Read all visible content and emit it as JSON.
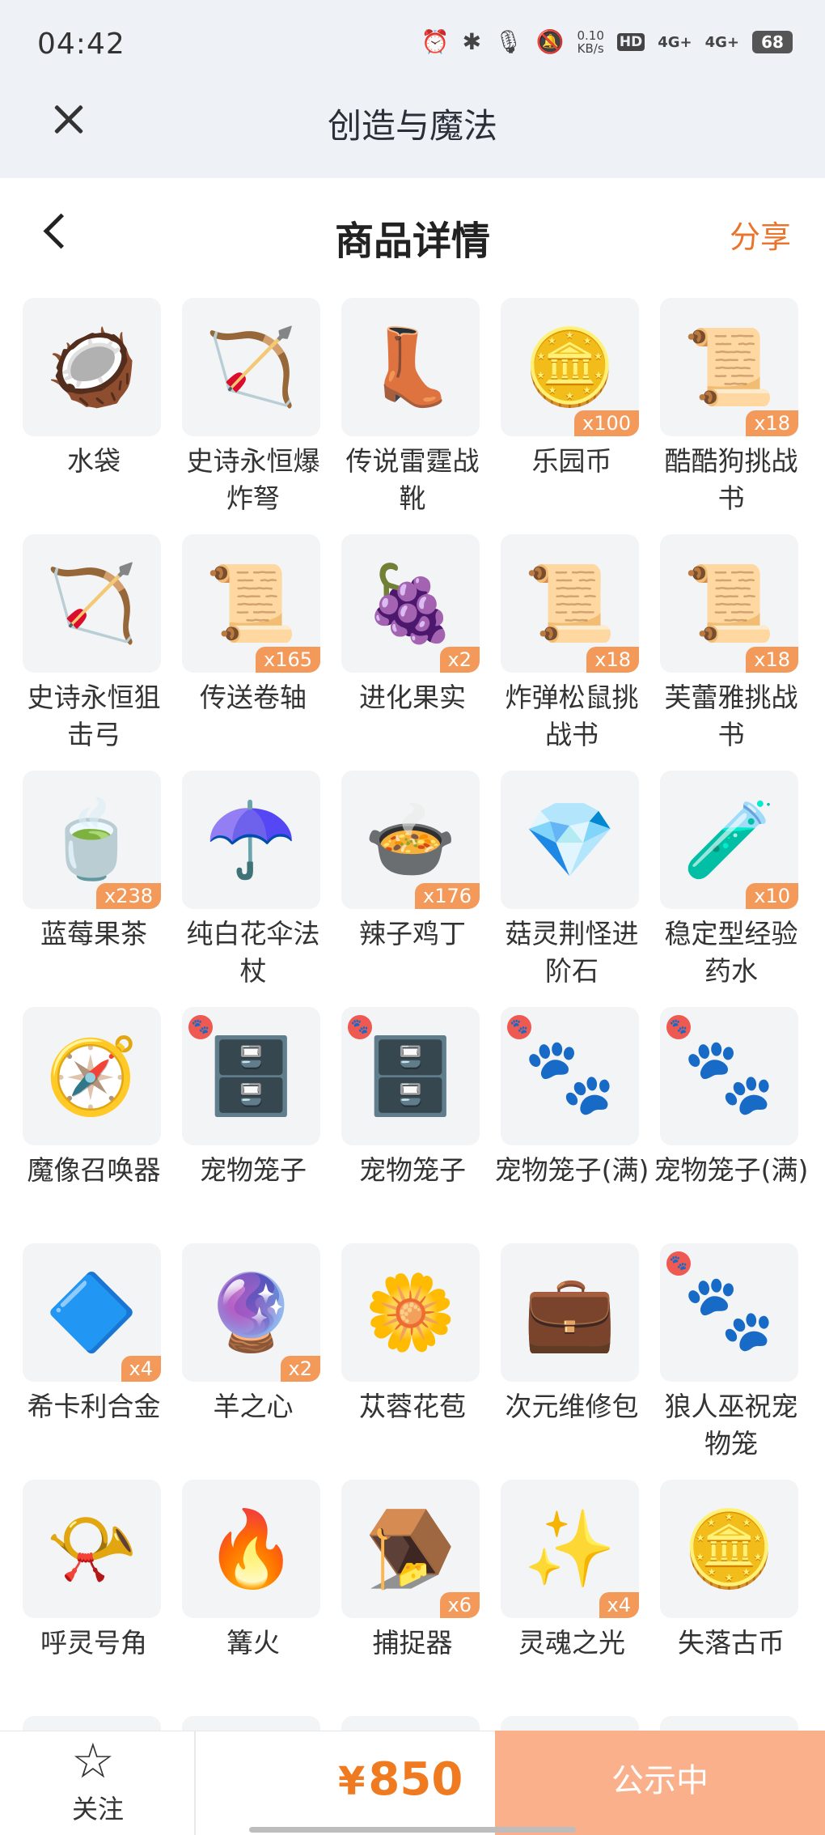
{
  "status_bar": {
    "time": "04:42",
    "net_speed_value": "0.10",
    "net_speed_unit": "KB/s",
    "hd_label": "HD",
    "signal_1": "4G+",
    "signal_2": "4G+",
    "battery": "68"
  },
  "header": {
    "app_title": "创造与魔法"
  },
  "page": {
    "title": "商品详情",
    "share_label": "分享"
  },
  "items": [
    {
      "name": "水袋",
      "qty": "",
      "icon": "water-bag-icon",
      "glyph": "🥥",
      "paw": false
    },
    {
      "name": "史诗永恒爆炸弩",
      "qty": "",
      "icon": "crossbow-icon",
      "glyph": "🏹",
      "paw": false
    },
    {
      "name": "传说雷霆战靴",
      "qty": "",
      "icon": "boots-icon",
      "glyph": "👢",
      "paw": false
    },
    {
      "name": "乐园币",
      "qty": "x100",
      "icon": "coin-icon",
      "glyph": "🪙",
      "paw": false
    },
    {
      "name": "酷酷狗挑战书",
      "qty": "x18",
      "icon": "wanted-scroll-icon",
      "glyph": "📜",
      "paw": false
    },
    {
      "name": "史诗永恒狙击弓",
      "qty": "",
      "icon": "bow-icon",
      "glyph": "🏹",
      "paw": false
    },
    {
      "name": "传送卷轴",
      "qty": "x165",
      "icon": "scroll-icon",
      "glyph": "📜",
      "paw": false
    },
    {
      "name": "进化果实",
      "qty": "x2",
      "icon": "fruit-icon",
      "glyph": "🍇",
      "paw": false
    },
    {
      "name": "炸弹松鼠挑战书",
      "qty": "x18",
      "icon": "wanted-scroll-icon",
      "glyph": "📜",
      "paw": false
    },
    {
      "name": "芙蕾雅挑战书",
      "qty": "x18",
      "icon": "wanted-scroll-icon",
      "glyph": "📜",
      "paw": false
    },
    {
      "name": "蓝莓果茶",
      "qty": "x238",
      "icon": "tea-icon",
      "glyph": "🍵",
      "paw": false
    },
    {
      "name": "纯白花伞法杖",
      "qty": "",
      "icon": "umbrella-icon",
      "glyph": "☂️",
      "paw": false
    },
    {
      "name": "辣子鸡丁",
      "qty": "x176",
      "icon": "dish-icon",
      "glyph": "🍲",
      "paw": false
    },
    {
      "name": "菇灵荆怪进阶石",
      "qty": "",
      "icon": "gem-icon",
      "glyph": "💎",
      "paw": false
    },
    {
      "name": "稳定型经验药水",
      "qty": "x10",
      "icon": "potion-icon",
      "glyph": "🧪",
      "paw": false
    },
    {
      "name": "魔像召唤器",
      "qty": "",
      "icon": "summoner-icon",
      "glyph": "🧭",
      "paw": false
    },
    {
      "name": "宠物笼子",
      "qty": "",
      "icon": "pet-cage-icon",
      "glyph": "🗄️",
      "paw": true
    },
    {
      "name": "宠物笼子",
      "qty": "",
      "icon": "pet-cage-icon",
      "glyph": "🗄️",
      "paw": true
    },
    {
      "name": "宠物笼子(满)",
      "qty": "",
      "icon": "pet-cage-full-icon",
      "glyph": "🐾",
      "paw": true
    },
    {
      "name": "宠物笼子(满)",
      "qty": "",
      "icon": "pet-cage-full-icon",
      "glyph": "🐾",
      "paw": true
    },
    {
      "name": "希卡利合金",
      "qty": "x4",
      "icon": "crystal-icon",
      "glyph": "🔷",
      "paw": false
    },
    {
      "name": "羊之心",
      "qty": "x2",
      "icon": "heart-orb-icon",
      "glyph": "🔮",
      "paw": false
    },
    {
      "name": "苁蓉花苞",
      "qty": "",
      "icon": "flower-bud-icon",
      "glyph": "🌼",
      "paw": false
    },
    {
      "name": "次元维修包",
      "qty": "",
      "icon": "repair-kit-icon",
      "glyph": "💼",
      "paw": false
    },
    {
      "name": "狼人巫祝宠物笼",
      "qty": "",
      "icon": "pet-cage-blue-icon",
      "glyph": "🐾",
      "paw": true
    },
    {
      "name": "呼灵号角",
      "qty": "",
      "icon": "horn-icon",
      "glyph": "📯",
      "paw": false
    },
    {
      "name": "篝火",
      "qty": "",
      "icon": "campfire-icon",
      "glyph": "🔥",
      "paw": false
    },
    {
      "name": "捕捉器",
      "qty": "x6",
      "icon": "trap-icon",
      "glyph": "🪤",
      "paw": false
    },
    {
      "name": "灵魂之光",
      "qty": "x4",
      "icon": "soul-light-icon",
      "glyph": "✨",
      "paw": false
    },
    {
      "name": "失落古币",
      "qty": "",
      "icon": "ancient-coin-icon",
      "glyph": "🪙",
      "paw": false
    },
    {
      "name": "",
      "qty": "",
      "icon": "gem-icon",
      "glyph": "💎",
      "paw": false
    },
    {
      "name": "",
      "qty": "",
      "icon": "crown-icon",
      "glyph": "👑",
      "paw": false
    },
    {
      "name": "",
      "qty": "",
      "icon": "amulet-icon",
      "glyph": "📿",
      "paw": false
    },
    {
      "name": "",
      "qty": "",
      "icon": "wing-icon",
      "glyph": "🪽",
      "paw": false
    },
    {
      "name": "",
      "qty": "",
      "icon": "sword-icon",
      "glyph": "🗡️",
      "paw": false
    }
  ],
  "bottom_bar": {
    "follow_label": "关注",
    "currency": "¥",
    "price": "850",
    "status_label": "公示中"
  },
  "colors": {
    "accent": "#e9742b",
    "badge": "#f39a5a",
    "status_button": "#fab08a",
    "price": "#f07a1f"
  }
}
